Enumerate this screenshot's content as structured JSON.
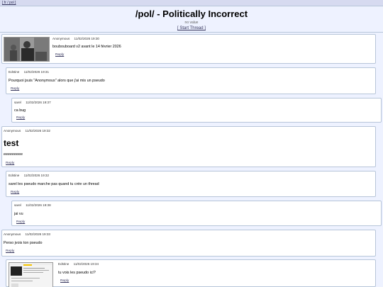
{
  "nav": {
    "links": "[ fr / pol ]"
  },
  "header": {
    "title": "/pol/ - Politically Incorrect",
    "subtitle": "no value",
    "start_thread": "[ Start Thread ]"
  },
  "posts": [
    {
      "name": "Anonymous",
      "date": "11/02/2026 19:30",
      "message": "boubouboard v2 avant le 14 février 2026",
      "reply": "Reply"
    },
    {
      "name": "Edstine",
      "date": "11/02/2026 19:31",
      "message": "Pourquoi jsuis \"Anonymous\" alors que j'ai mis un pseudo",
      "reply": "Reply"
    },
    {
      "name": "sarel",
      "date": "11/02/2026 19:37",
      "message": "ca bug",
      "reply": "Reply"
    },
    {
      "name": "Anonymous",
      "date": "11/02/2026 19:32",
      "message_big": "test",
      "message": "eeeeeeeee",
      "reply": "Reply"
    },
    {
      "name": "Edstine",
      "date": "11/02/2026 19:32",
      "message": "sarel les pseudo marche pas quand tu crée un thread",
      "reply": "Reply"
    },
    {
      "name": "sarel",
      "date": "11/02/2026 19:38",
      "message": "jai vu",
      "reply": "Reply"
    },
    {
      "name": "Anonymous",
      "date": "11/02/2026 19:33",
      "message": "Perso jvois ton pseudo",
      "reply": "Reply"
    },
    {
      "name": "Edstine",
      "date": "11/02/2026 19:34",
      "message": "tu vois les pseudo ici?",
      "reply": "Reply"
    }
  ]
}
